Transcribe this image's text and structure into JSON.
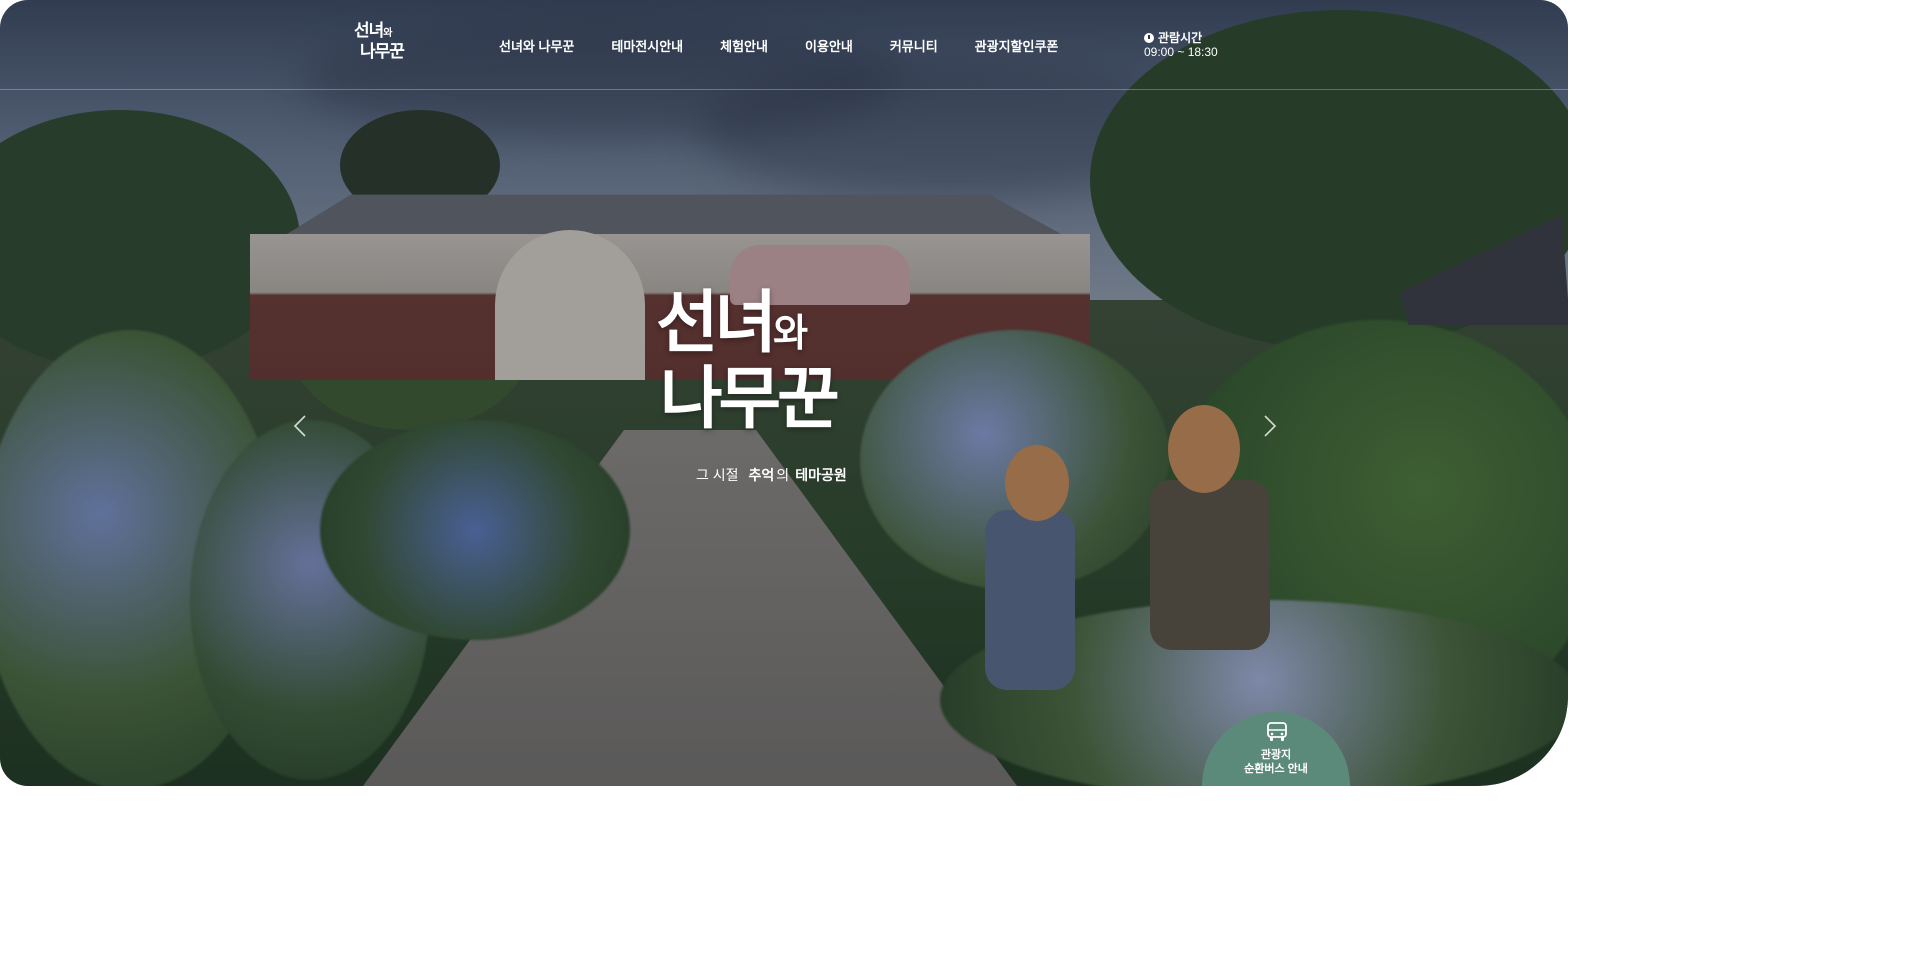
{
  "logo": {
    "line1": "선녀",
    "line1_small": "와",
    "line2": "나무꾼"
  },
  "nav": {
    "items": [
      {
        "label": "선녀와 나무꾼"
      },
      {
        "label": "테마전시안내"
      },
      {
        "label": "체험안내"
      },
      {
        "label": "이용안내"
      },
      {
        "label": "커뮤니티"
      },
      {
        "label": "관광지할인쿠폰"
      }
    ]
  },
  "hours": {
    "label": "관람시간",
    "value": "09:00 ~ 18:30"
  },
  "hero": {
    "title_line1": "선녀",
    "title_line1_small": "와",
    "title_line2": "나무꾼",
    "tagline_prefix": "그 시절",
    "tagline_highlight": "추억",
    "tagline_suffix": "의",
    "tagline_end": "테마공원"
  },
  "bus": {
    "line1": "관광지",
    "line2": "순환버스 안내"
  },
  "icons": {
    "clock": "clock-icon",
    "prev": "chevron-left-icon",
    "next": "chevron-right-icon",
    "bus": "bus-icon"
  },
  "colors": {
    "highlight_circle": "#3d6fb3",
    "bus_button": "#5c8a7a",
    "text": "#ffffff"
  }
}
